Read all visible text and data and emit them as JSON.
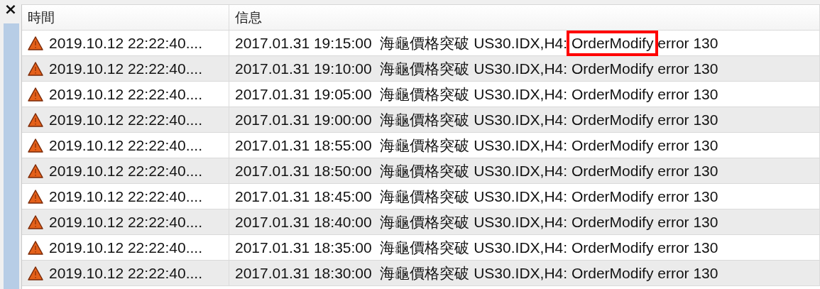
{
  "close_button": "×",
  "table": {
    "columns": [
      "時間",
      "信息"
    ],
    "rows": [
      {
        "time": "2019.10.12 22:22:40....",
        "message": [
          {
            "text": "2017.01.31 19:15:00  海龜價格突破 US30.IDX,H4: ",
            "boxed": false
          },
          {
            "text": "OrderModify",
            "boxed": true
          },
          {
            "text": " error 130",
            "boxed": false
          }
        ]
      },
      {
        "time": "2019.10.12 22:22:40....",
        "message": [
          {
            "text": "2017.01.31 19:10:00  海龜價格突破 US30.IDX,H4: OrderModify error 130",
            "boxed": false
          }
        ]
      },
      {
        "time": "2019.10.12 22:22:40....",
        "message": [
          {
            "text": "2017.01.31 19:05:00  海龜價格突破 US30.IDX,H4: OrderModify error 130",
            "boxed": false
          }
        ]
      },
      {
        "time": "2019.10.12 22:22:40....",
        "message": [
          {
            "text": "2017.01.31 19:00:00  海龜價格突破 US30.IDX,H4: OrderModify error 130",
            "boxed": false
          }
        ]
      },
      {
        "time": "2019.10.12 22:22:40....",
        "message": [
          {
            "text": "2017.01.31 18:55:00  海龜價格突破 US30.IDX,H4: OrderModify error 130",
            "boxed": false
          }
        ]
      },
      {
        "time": "2019.10.12 22:22:40....",
        "message": [
          {
            "text": "2017.01.31 18:50:00  海龜價格突破 US30.IDX,H4: OrderModify error 130",
            "boxed": false
          }
        ]
      },
      {
        "time": "2019.10.12 22:22:40....",
        "message": [
          {
            "text": "2017.01.31 18:45:00  海龜價格突破 US30.IDX,H4: OrderModify error 130",
            "boxed": false
          }
        ]
      },
      {
        "time": "2019.10.12 22:22:40....",
        "message": [
          {
            "text": "2017.01.31 18:40:00  海龜價格突破 US30.IDX,H4: OrderModify error 130",
            "boxed": false
          }
        ]
      },
      {
        "time": "2019.10.12 22:22:40....",
        "message": [
          {
            "text": "2017.01.31 18:35:00  海龜價格突破 US30.IDX,H4: OrderModify error 130",
            "boxed": false
          }
        ]
      },
      {
        "time": "2019.10.12 22:22:40....",
        "message": [
          {
            "text": "2017.01.31 18:30:00  海龜價格突破 US30.IDX,H4: OrderModify error 130",
            "boxed": false
          }
        ]
      }
    ]
  }
}
